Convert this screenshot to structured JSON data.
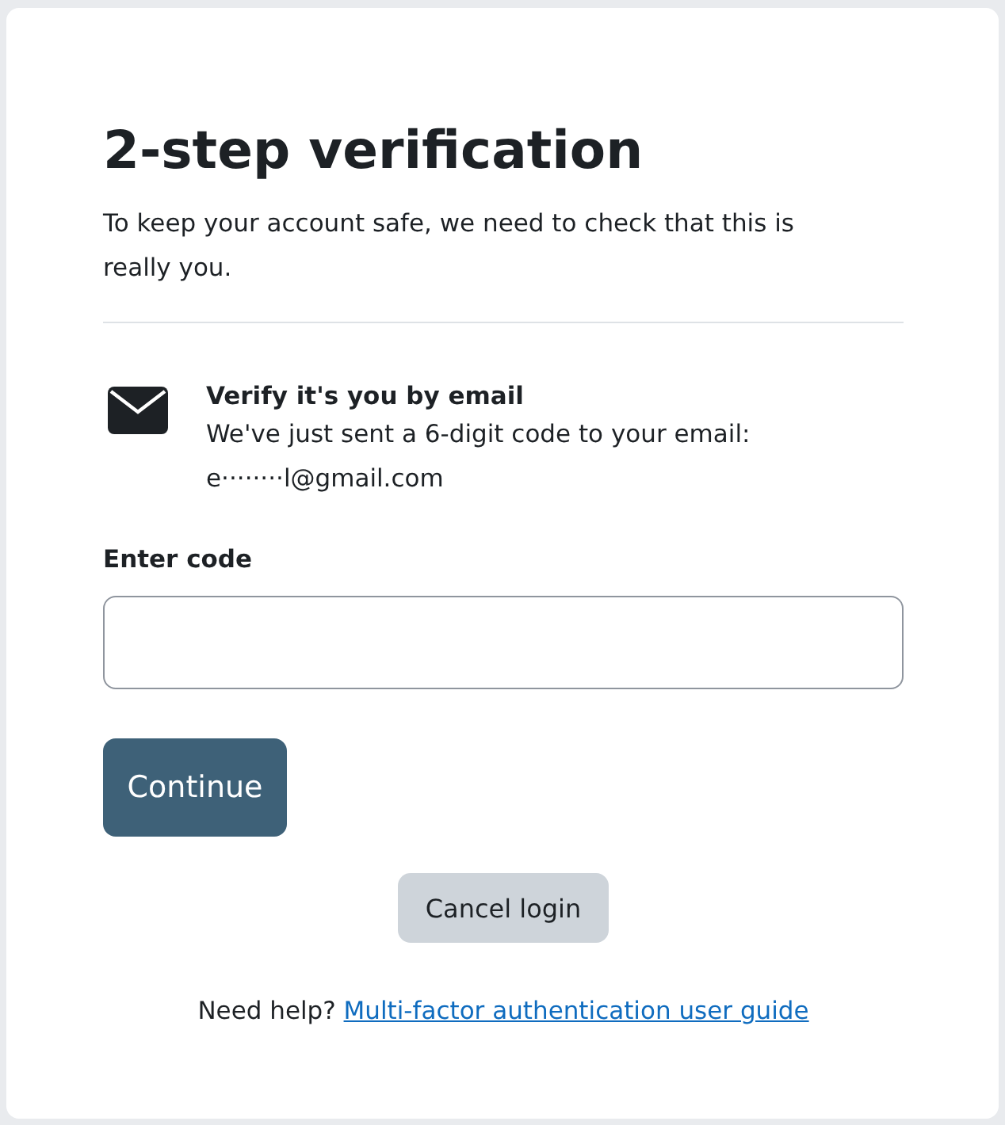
{
  "title": "2-step verification",
  "intro": "To keep your account safe, we need to check that this is really you.",
  "method": {
    "heading": "Verify it's you by email",
    "message": "We've just sent a 6-digit code to your email:",
    "address": "e········l@gmail.com"
  },
  "code_field": {
    "label": "Enter code"
  },
  "buttons": [
    {
      "label": "Continue",
      "kind": "primary"
    },
    {
      "label": "Cancel login",
      "kind": "secondary"
    }
  ],
  "help": {
    "prefix": "Need help?",
    "link": "Multi-factor authentication user guide"
  }
}
